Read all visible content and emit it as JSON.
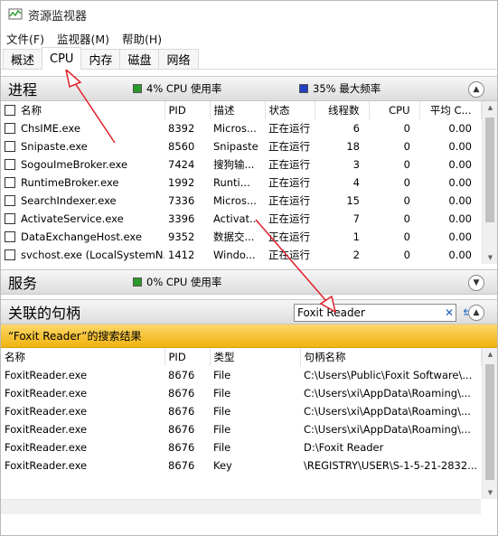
{
  "window": {
    "title": "资源监视器"
  },
  "menu": [
    {
      "label": "文件(F)"
    },
    {
      "label": "监视器(M)"
    },
    {
      "label": "帮助(H)"
    }
  ],
  "tabs": [
    {
      "label": "概述"
    },
    {
      "label": "CPU",
      "active": true
    },
    {
      "label": "内存"
    },
    {
      "label": "磁盘"
    },
    {
      "label": "网络"
    }
  ],
  "processes": {
    "title": "进程",
    "cpu_usage": "4% CPU 使用率",
    "max_freq": "35% 最大频率",
    "columns": [
      "名称",
      "PID",
      "描述",
      "状态",
      "线程数",
      "CPU",
      "平均 C..."
    ],
    "rows": [
      {
        "name": "ChsIME.exe",
        "pid": "8392",
        "desc": "Micros...",
        "status": "正在运行",
        "threads": "6",
        "cpu": "0",
        "avg": "0.00"
      },
      {
        "name": "Snipaste.exe",
        "pid": "8560",
        "desc": "Snipaste",
        "status": "正在运行",
        "threads": "18",
        "cpu": "0",
        "avg": "0.00"
      },
      {
        "name": "SogouImeBroker.exe",
        "pid": "7424",
        "desc": "搜狗输...",
        "status": "正在运行",
        "threads": "3",
        "cpu": "0",
        "avg": "0.00"
      },
      {
        "name": "RuntimeBroker.exe",
        "pid": "1992",
        "desc": "Runti...",
        "status": "正在运行",
        "threads": "4",
        "cpu": "0",
        "avg": "0.00"
      },
      {
        "name": "SearchIndexer.exe",
        "pid": "7336",
        "desc": "Micros...",
        "status": "正在运行",
        "threads": "15",
        "cpu": "0",
        "avg": "0.00"
      },
      {
        "name": "ActivateService.exe",
        "pid": "3396",
        "desc": "Activat...",
        "status": "正在运行",
        "threads": "7",
        "cpu": "0",
        "avg": "0.00"
      },
      {
        "name": "DataExchangeHost.exe",
        "pid": "9352",
        "desc": "数据交...",
        "status": "正在运行",
        "threads": "1",
        "cpu": "0",
        "avg": "0.00"
      },
      {
        "name": "svchost.exe (LocalSystemN...",
        "pid": "1412",
        "desc": "Windo...",
        "status": "正在运行",
        "threads": "2",
        "cpu": "0",
        "avg": "0.00"
      }
    ]
  },
  "services": {
    "title": "服务",
    "cpu_usage": "0% CPU 使用率"
  },
  "handles": {
    "title": "关联的句柄",
    "search_value": "Foxit Reader",
    "result_label": "“Foxit Reader”的搜索结果",
    "columns": [
      "名称",
      "PID",
      "类型",
      "句柄名称"
    ],
    "rows": [
      {
        "name": "FoxitReader.exe",
        "pid": "8676",
        "type": "File",
        "handle": "C:\\Users\\Public\\Foxit Software\\..."
      },
      {
        "name": "FoxitReader.exe",
        "pid": "8676",
        "type": "File",
        "handle": "C:\\Users\\xi\\AppData\\Roaming\\..."
      },
      {
        "name": "FoxitReader.exe",
        "pid": "8676",
        "type": "File",
        "handle": "C:\\Users\\xi\\AppData\\Roaming\\..."
      },
      {
        "name": "FoxitReader.exe",
        "pid": "8676",
        "type": "File",
        "handle": "C:\\Users\\xi\\AppData\\Roaming\\..."
      },
      {
        "name": "FoxitReader.exe",
        "pid": "8676",
        "type": "File",
        "handle": "D:\\Foxit Reader"
      },
      {
        "name": "FoxitReader.exe",
        "pid": "8676",
        "type": "Key",
        "handle": "\\REGISTRY\\USER\\S-1-5-21-2832..."
      }
    ]
  },
  "colors": {
    "cpu_swatch": "#2a9a2a",
    "freq_swatch": "#2040c0",
    "annotation_arrow": "#e0202a",
    "result_bar": "#f5c02a"
  }
}
